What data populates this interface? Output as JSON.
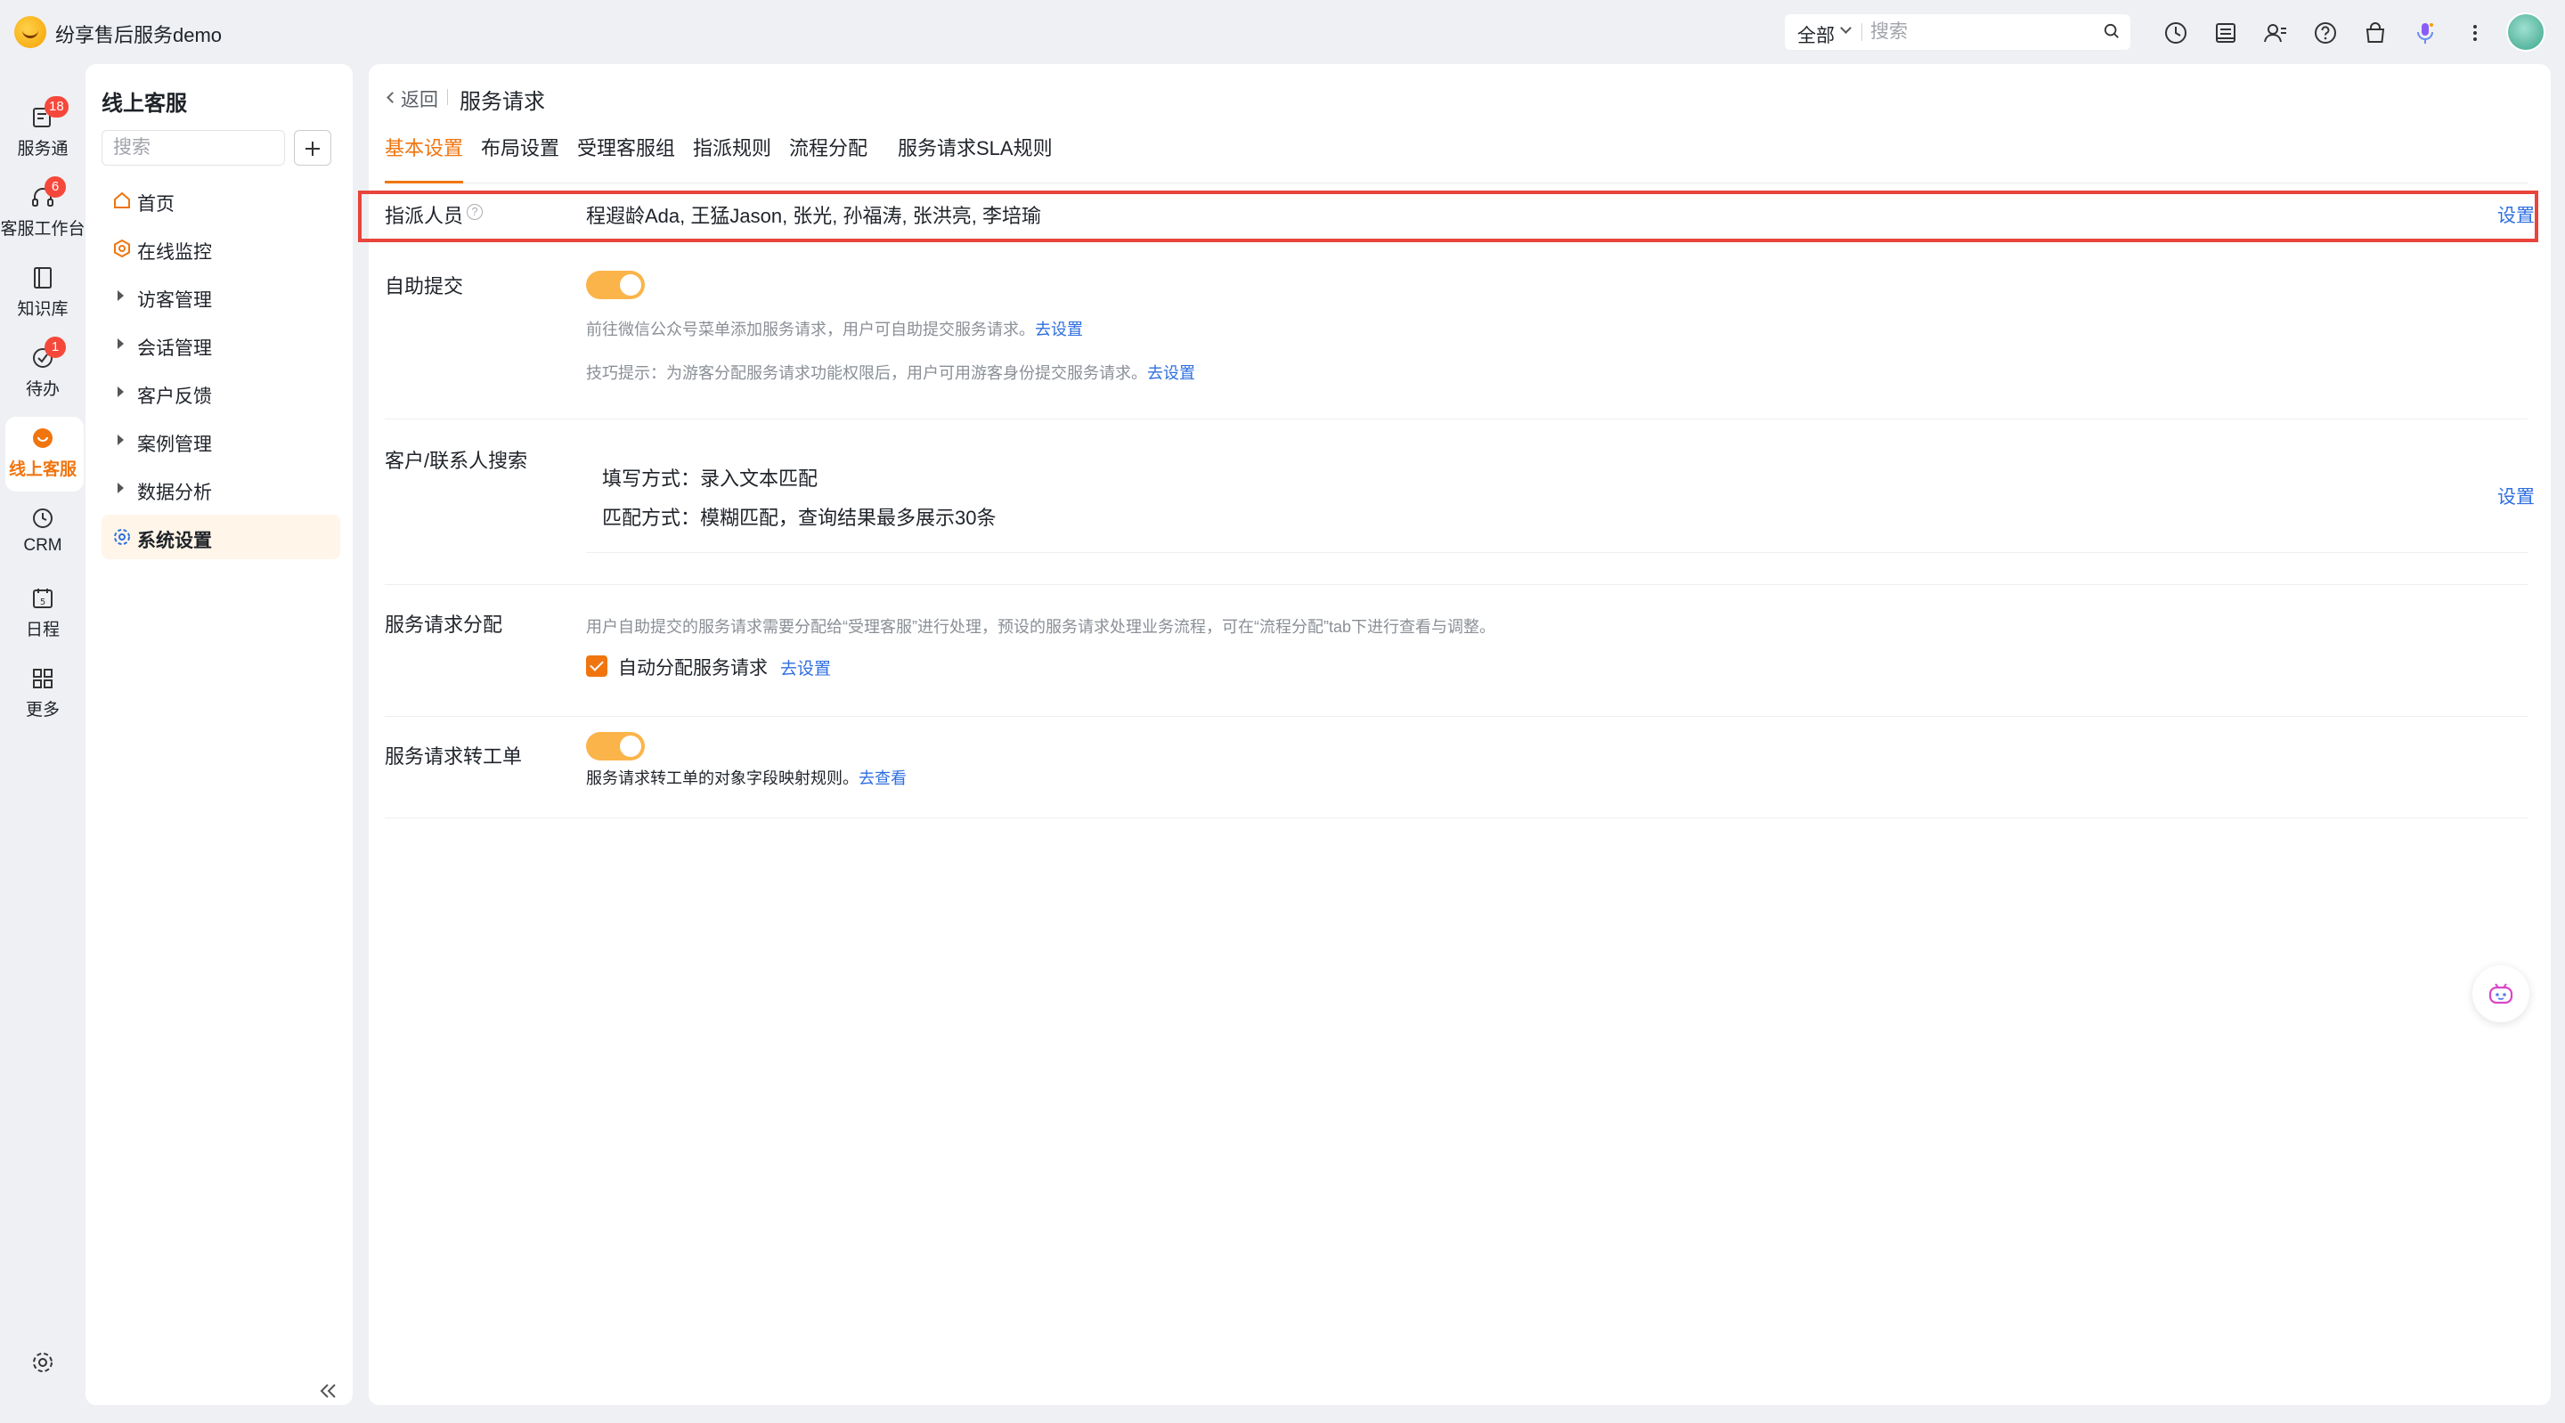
{
  "app": {
    "title": "纷享售后服务demo"
  },
  "topbar": {
    "scope": "全部",
    "search_placeholder": "搜索",
    "icons": [
      "history-icon",
      "inbox-icon",
      "contacts-icon",
      "help-icon",
      "bag-icon",
      "mic-icon",
      "more-icon"
    ]
  },
  "rail": {
    "items": [
      {
        "label": "服务通",
        "badge": "18",
        "icon": "service-icon"
      },
      {
        "label": "客服工作台",
        "badge": "6",
        "icon": "headset-icon"
      },
      {
        "label": "知识库",
        "badge": "",
        "icon": "book-icon"
      },
      {
        "label": "待办",
        "badge": "1",
        "icon": "todo-icon"
      },
      {
        "label": "线上客服",
        "badge": "",
        "icon": "chat-icon",
        "active": true
      },
      {
        "label": "CRM",
        "badge": "",
        "icon": "clock-icon"
      },
      {
        "label": "日程",
        "badge": "",
        "icon": "calendar-icon"
      },
      {
        "label": "更多",
        "badge": "",
        "icon": "grid-icon"
      }
    ],
    "accent": "#f0750f"
  },
  "sidebar": {
    "title": "线上客服",
    "search_placeholder": "搜索",
    "items": [
      {
        "label": "首页",
        "kind": "home-icon"
      },
      {
        "label": "在线监控",
        "kind": "monitor-icon"
      },
      {
        "label": "访客管理",
        "kind": "caret"
      },
      {
        "label": "会话管理",
        "kind": "caret"
      },
      {
        "label": "客户反馈",
        "kind": "caret"
      },
      {
        "label": "案例管理",
        "kind": "caret"
      },
      {
        "label": "数据分析",
        "kind": "caret"
      },
      {
        "label": "系统设置",
        "kind": "gear-icon",
        "active": true
      }
    ]
  },
  "main": {
    "back": "返回",
    "title": "服务请求",
    "tabs": [
      "基本设置",
      "布局设置",
      "受理客服组",
      "指派规则",
      "流程分配",
      "服务请求SLA规则"
    ],
    "active_tab": 0,
    "assignee": {
      "label": "指派人员",
      "value": "程遐龄Ada, 王猛Jason, 张光, 孙福涛, 张洪亮, 李培瑜",
      "action": "设置"
    },
    "self_submit": {
      "label": "自助提交",
      "enabled": true,
      "hint1": "前往微信公众号菜单添加服务请求，用户可自助提交服务请求。",
      "hint1_link": "去设置",
      "hint2": "技巧提示：为游客分配服务请求功能权限后，用户可用游客身份提交服务请求。",
      "hint2_link": "去设置"
    },
    "customer_search": {
      "label": "客户/联系人搜索",
      "fill_mode": "填写方式：录入文本匹配",
      "match_mode": "匹配方式：模糊匹配，查询结果最多展示30条",
      "action": "设置"
    },
    "distribution": {
      "label": "服务请求分配",
      "hint": "用户自助提交的服务请求需要分配给“受理客服”进行处理，预设的服务请求处理业务流程，可在“流程分配”tab下进行查看与调整。",
      "checkbox_label": "自动分配服务请求",
      "checked": true,
      "link": "去设置"
    },
    "to_ticket": {
      "label": "服务请求转工单",
      "enabled": true,
      "hint": "服务请求转工单的对象字段映射规则。",
      "link": "去查看"
    }
  },
  "colors": {
    "accent": "#f0750f",
    "link": "#2f6fe0",
    "highlight": "#e8443b",
    "toggle": "#fbb44a"
  }
}
